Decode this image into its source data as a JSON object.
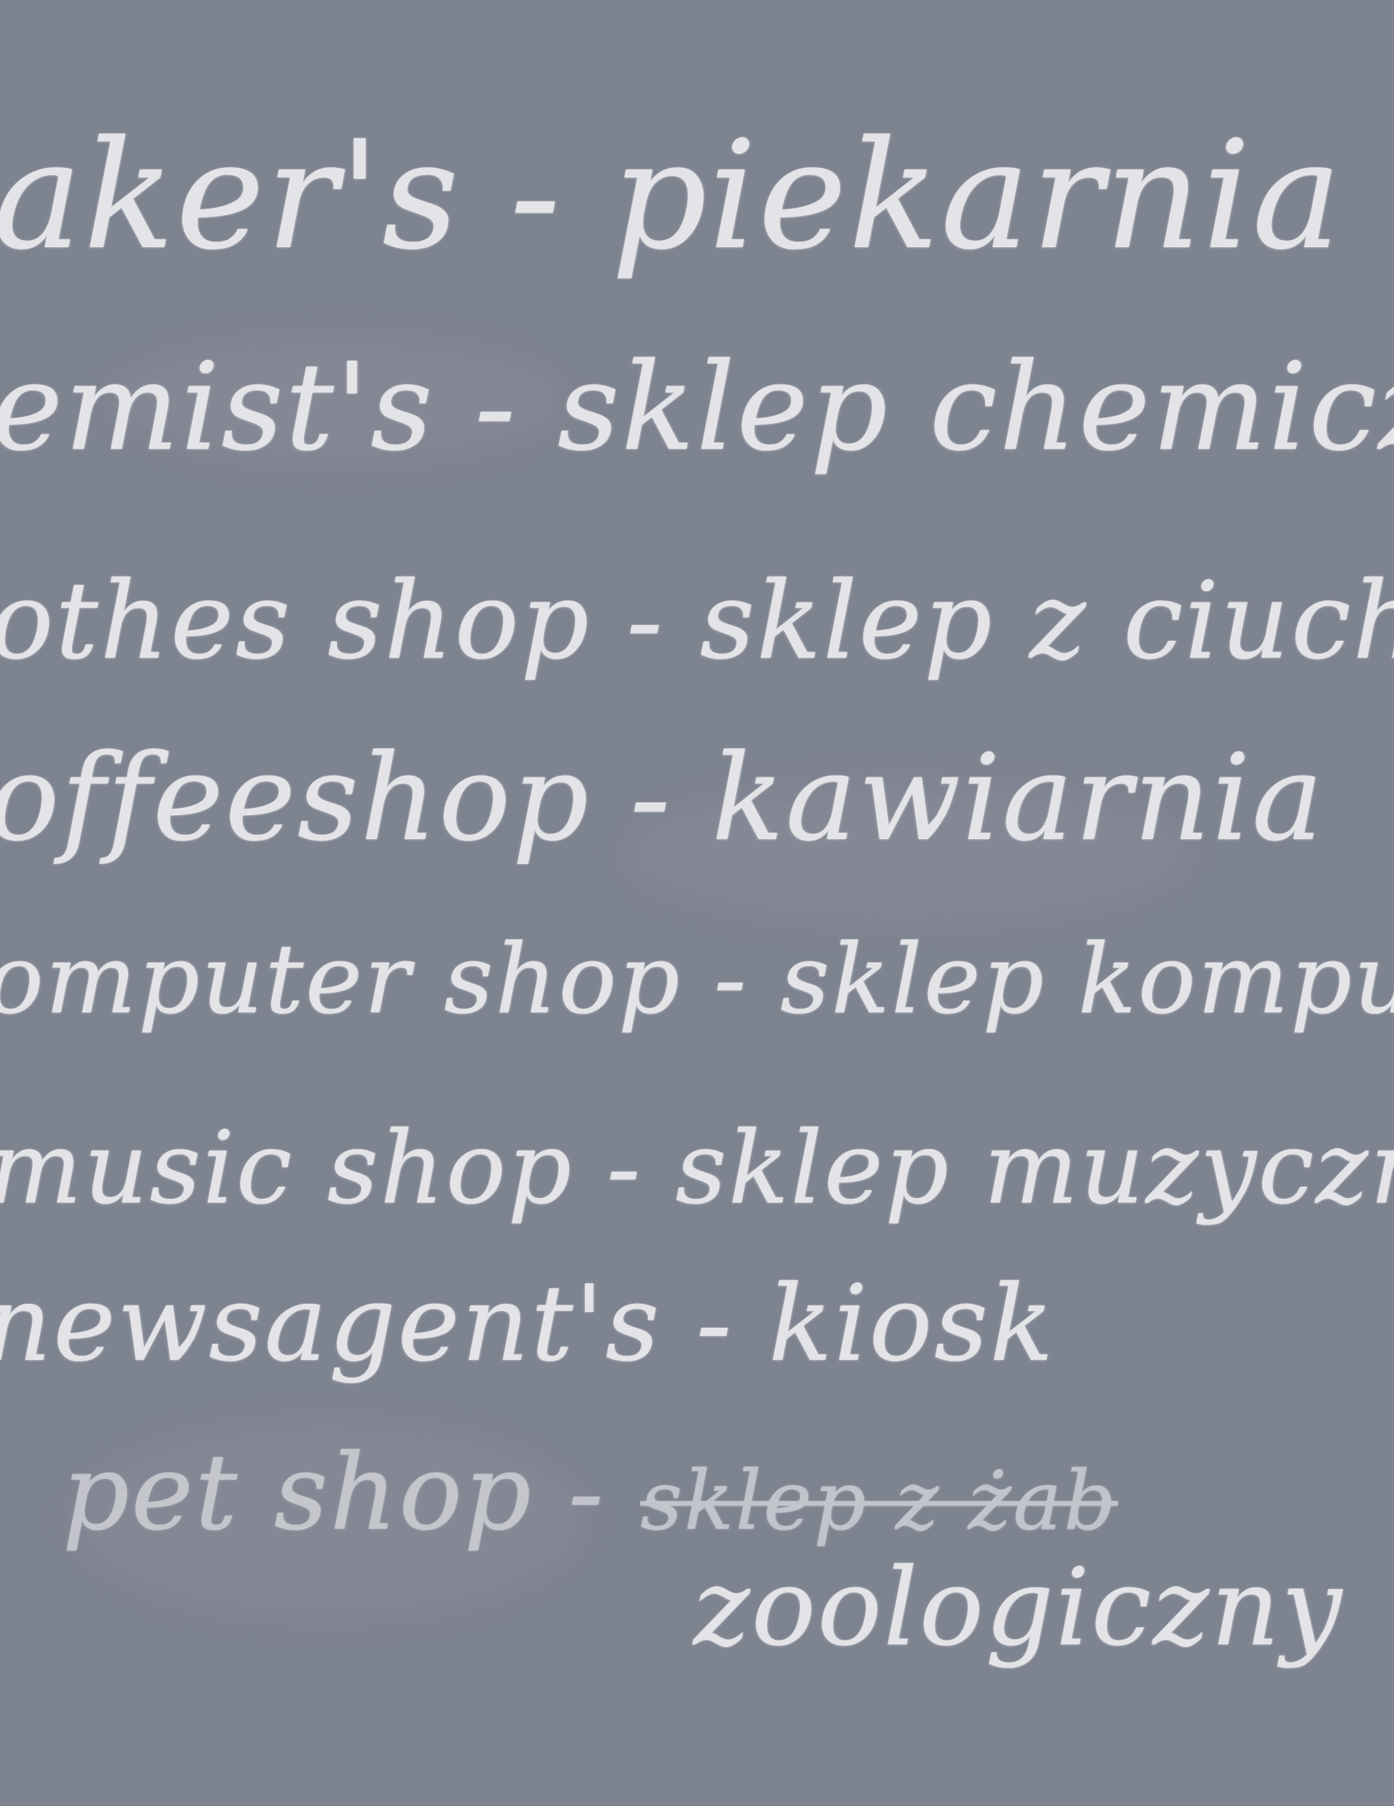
{
  "board": {
    "background": "#7e8390",
    "chalk_color": "#ececef"
  },
  "lines": [
    {
      "english": "aker's",
      "dash": "-",
      "polish": "piekarnia"
    },
    {
      "english": "emist's",
      "dash": "-",
      "polish": "sklep chemiczny"
    },
    {
      "english": "othes shop",
      "dash": "-",
      "polish": "sklep z ciuchami"
    },
    {
      "english": "offeeshop",
      "dash": "-",
      "polish": "kawiarnia"
    },
    {
      "english": "omputer shop",
      "dash": "-",
      "polish": "sklep komputerowy"
    },
    {
      "english": "music shop",
      "dash": "-",
      "polish": "sklep muzyczny"
    },
    {
      "english": "newsagent's",
      "dash": "-",
      "polish": "kiosk"
    },
    {
      "english": "pet shop",
      "dash": "-",
      "polish_crossed_out": "sklep z żab",
      "polish": "zoologiczny"
    }
  ]
}
